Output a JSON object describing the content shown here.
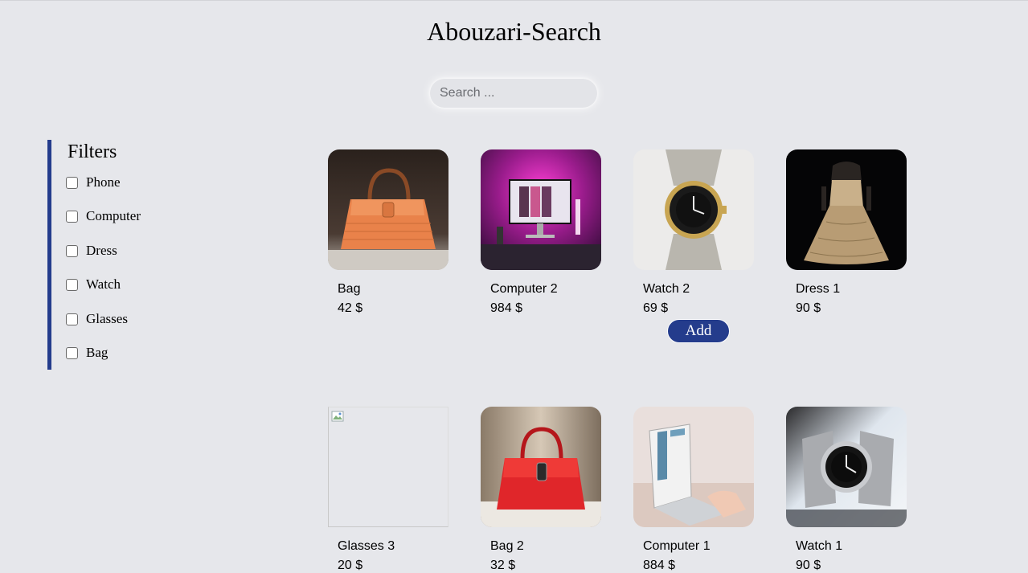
{
  "header": {
    "title": "Abouzari-Search"
  },
  "search": {
    "placeholder": "Search ..."
  },
  "filters": {
    "title": "Filters",
    "items": [
      {
        "label": "Phone",
        "checked": false
      },
      {
        "label": "Computer",
        "checked": false
      },
      {
        "label": "Dress",
        "checked": false
      },
      {
        "label": "Watch",
        "checked": false
      },
      {
        "label": "Glasses",
        "checked": false
      },
      {
        "label": "Bag",
        "checked": false
      }
    ]
  },
  "products": [
    {
      "name": "Bag",
      "price": "42 $",
      "image": "orange-bag"
    },
    {
      "name": "Computer 2",
      "price": "984 $",
      "image": "pink-computer"
    },
    {
      "name": "Watch 2",
      "price": "69 $",
      "image": "watch",
      "add_label": "Add"
    },
    {
      "name": "Dress 1",
      "price": "90 $",
      "image": "dress"
    },
    {
      "name": "Glasses 3",
      "price": "20 $",
      "image": "broken-image"
    },
    {
      "name": "Bag 2",
      "price": "32 $",
      "image": "red-bag"
    },
    {
      "name": "Computer 1",
      "price": "884 $",
      "image": "laptop"
    },
    {
      "name": "Watch 1",
      "price": "90 $",
      "image": "watch-2"
    }
  ],
  "colors": {
    "accent": "#243c8c",
    "background": "#e6e7eb"
  }
}
